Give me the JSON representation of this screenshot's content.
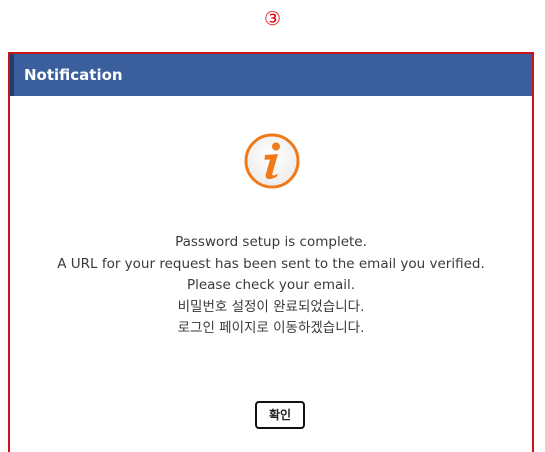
{
  "step_marker": "③",
  "dialog": {
    "title": "Notification",
    "icon": "info-icon",
    "message_lines": [
      "Password setup is complete.",
      "A URL for your request has been sent to the email you verified.",
      "Please check your email.",
      "비밀번호 설정이 완료되었습니다.",
      "로그인 페이지로 이동하겠습니다."
    ],
    "confirm_label": "확인"
  },
  "colors": {
    "header_bg": "#3a5f9c",
    "border_accent": "#c8151d",
    "icon_orange": "#f07a1a",
    "step_marker": "#e10000"
  }
}
